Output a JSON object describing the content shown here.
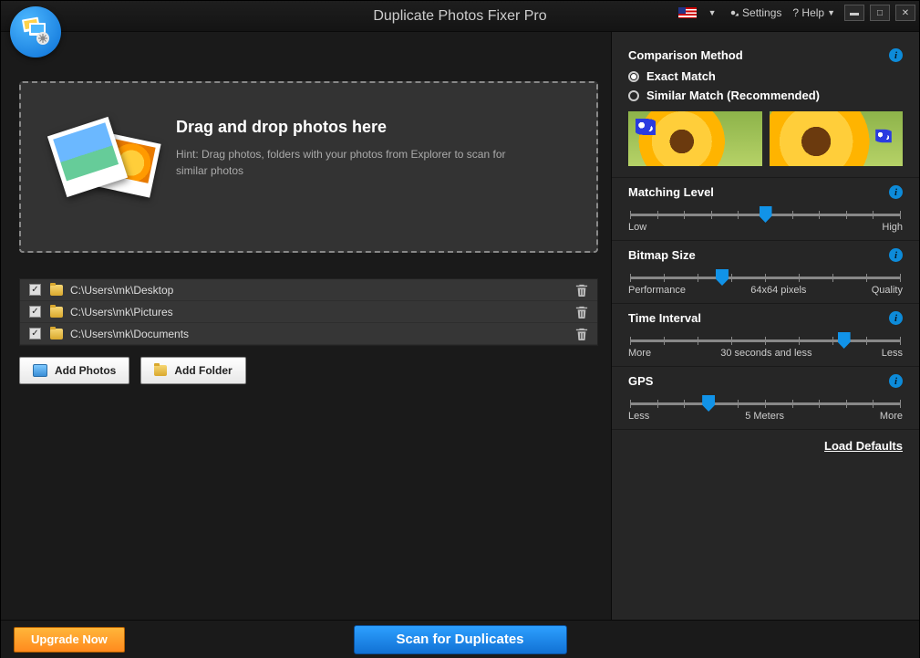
{
  "app": {
    "title": "Duplicate Photos Fixer Pro",
    "settings": "Settings",
    "help": "? Help"
  },
  "drop": {
    "title": "Drag and drop photos here",
    "hint": "Hint: Drag photos, folders with your photos from Explorer to scan for similar photos"
  },
  "folders": [
    {
      "path": "C:\\Users\\mk\\Desktop",
      "checked": true
    },
    {
      "path": "C:\\Users\\mk\\Pictures",
      "checked": true
    },
    {
      "path": "C:\\Users\\mk\\Documents",
      "checked": true
    }
  ],
  "buttons": {
    "add_photos": "Add Photos",
    "add_folder": "Add Folder",
    "upgrade": "Upgrade Now",
    "scan": "Scan for Duplicates",
    "load_defaults": "Load Defaults"
  },
  "comparison": {
    "heading": "Comparison Method",
    "exact": "Exact Match",
    "similar": "Similar Match (Recommended)",
    "selected": "exact"
  },
  "sliders": {
    "matching": {
      "heading": "Matching Level",
      "left": "Low",
      "right": "High",
      "pos": 50,
      "ticks": 11
    },
    "bitmap": {
      "heading": "Bitmap Size",
      "left": "Performance",
      "right": "Quality",
      "mid": "64x64 pixels",
      "pos": 34,
      "ticks": 9
    },
    "time": {
      "heading": "Time Interval",
      "left": "More",
      "right": "Less",
      "mid": "30 seconds and less",
      "pos": 79,
      "ticks": 9
    },
    "gps": {
      "heading": "GPS",
      "left": "Less",
      "right": "More",
      "mid": "5 Meters",
      "pos": 29,
      "ticks": 11
    }
  }
}
